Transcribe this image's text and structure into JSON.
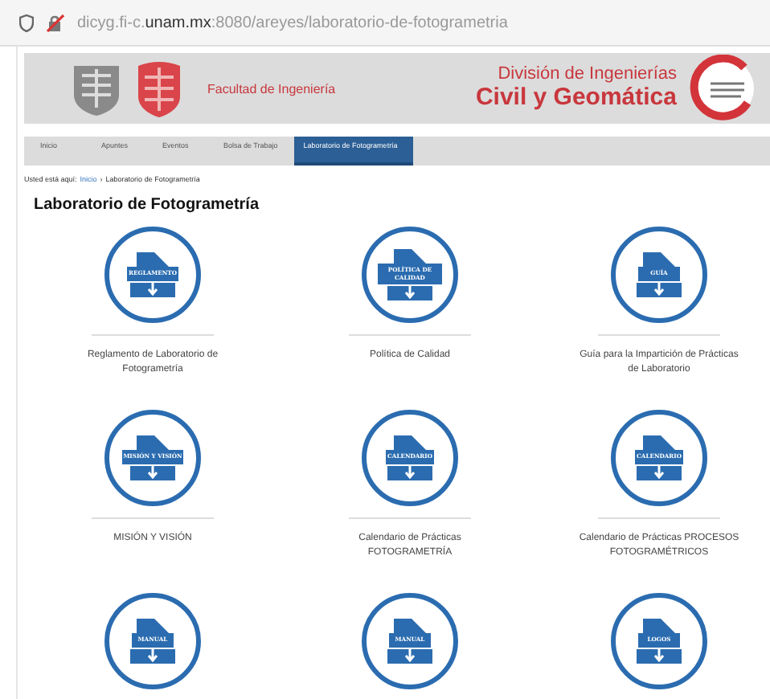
{
  "address_bar": {
    "url": "dicyg.fi-c.**unam.mx**:8080/areyes/laboratorio-de-fotogrametria"
  },
  "header": {
    "faculty": "Facultad de Ingeniería",
    "division_line_1": "División de Ingenierías",
    "division_line_2": "Civil y Geomática"
  },
  "nav": [
    {
      "label": "Inicio",
      "selected": false
    },
    {
      "label": "Apuntes",
      "selected": false
    },
    {
      "label": "Eventos",
      "selected": false
    },
    {
      "label": "Bolsa de Trabajo",
      "selected": false
    },
    {
      "label": "Laboratorio de Fotogrametría",
      "selected": true
    }
  ],
  "breadcrumb": {
    "prefix": "Usted está aquí:",
    "link": "Inicio",
    "separator": "›",
    "current": "Laboratorio de Fotogrametría"
  },
  "page_title": "Laboratorio de Fotogrametría",
  "items": [
    {
      "icon_label": "REGLAMENTO",
      "caption": "Reglamento de Laboratorio de Fotogrametría"
    },
    {
      "icon_label": "POLÍTICA DE CALIDAD",
      "caption": "Política de Calidad"
    },
    {
      "icon_label": "GUÍA",
      "caption": "Guía para la Impartición de Prácticas de Laboratorio"
    },
    {
      "icon_label": "MISIÓN Y VISIÓN",
      "caption": "MISIÓN Y VISIÓN"
    },
    {
      "icon_label": "CALENDARIO",
      "caption": "Calendario de Prácticas FOTOGRAMETRÍA"
    },
    {
      "icon_label": "CALENDARIO",
      "caption": "Calendario de Prácticas PROCESOS FOTOGRAMÉTRICOS"
    },
    {
      "icon_label": "MANUAL"
    },
    {
      "icon_label": "MANUAL"
    },
    {
      "icon_label": "LOGOS"
    }
  ]
}
